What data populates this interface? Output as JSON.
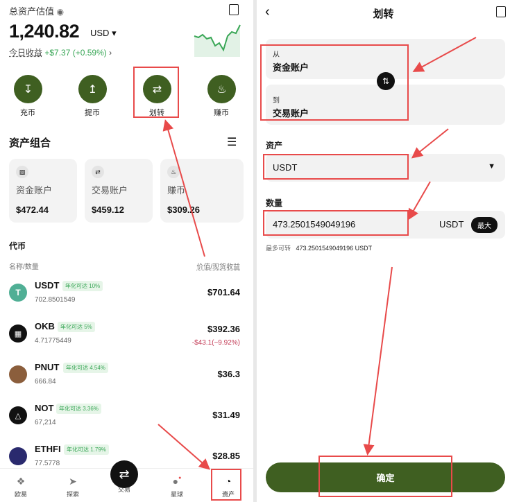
{
  "left": {
    "estimate_label": "总资产估值",
    "total_value": "1,240.82",
    "currency": "USD",
    "pnl_label": "今日收益",
    "pnl_value": "+$7.37 (+0.59%)",
    "actions": [
      {
        "label": "充币",
        "icon": "download-icon"
      },
      {
        "label": "提币",
        "icon": "upload-icon"
      },
      {
        "label": "划转",
        "icon": "transfer-icon"
      },
      {
        "label": "赚币",
        "icon": "earn-icon"
      }
    ],
    "portfolio_title": "资产组合",
    "accounts": [
      {
        "name": "资金账户",
        "value": "$472.44"
      },
      {
        "name": "交易账户",
        "value": "$459.12"
      },
      {
        "name": "赚币",
        "value": "$309.26"
      }
    ],
    "tokens_title": "代币",
    "col_name": "名称/数量",
    "col_value": "价值/现货收益",
    "coins": [
      {
        "symbol": "USDT",
        "tag": "年化可达 10%",
        "amount": "702.8501549",
        "value": "$701.64",
        "change": ""
      },
      {
        "symbol": "OKB",
        "tag": "年化可达 5%",
        "amount": "4.71775449",
        "value": "$392.36",
        "change": "-$43.1(−9.92%)"
      },
      {
        "symbol": "PNUT",
        "tag": "年化可达 4.54%",
        "amount": "666.84",
        "value": "$36.3",
        "change": ""
      },
      {
        "symbol": "NOT",
        "tag": "年化可达 3.36%",
        "amount": "67,214",
        "value": "$31.49",
        "change": ""
      },
      {
        "symbol": "ETHFI",
        "tag": "年化可达 1.79%",
        "amount": "77.5778",
        "value": "$28.85",
        "change": ""
      }
    ],
    "nav": [
      {
        "label": "欧易",
        "icon": "grid-icon"
      },
      {
        "label": "探索",
        "icon": "compass-icon"
      },
      {
        "label": "交易",
        "icon": "trade-icon"
      },
      {
        "label": "星球",
        "icon": "planet-icon"
      },
      {
        "label": "资产",
        "icon": "pie-chart-icon"
      }
    ]
  },
  "right": {
    "title": "划转",
    "from_label": "从",
    "from_value": "资金账户",
    "to_label": "到",
    "to_value": "交易账户",
    "asset_label": "资产",
    "asset_value": "USDT",
    "amount_label": "数量",
    "amount_value": "473.2501549049196",
    "amount_unit": "USDT",
    "max_label": "最大",
    "available_label": "最多可转",
    "available_value": "473.2501549049196 USDT",
    "confirm_label": "确定"
  },
  "colors": {
    "accent": "#3f5f21",
    "positive": "#3aa757",
    "negative": "#c33a55",
    "highlight": "#e84a4a"
  }
}
